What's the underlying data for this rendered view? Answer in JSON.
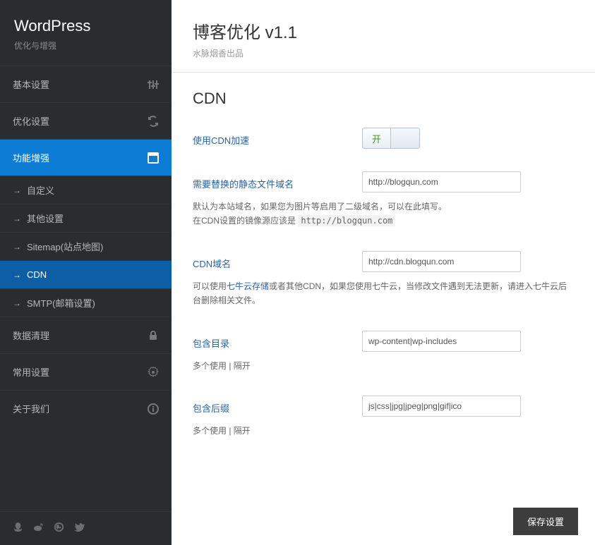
{
  "brand": {
    "title": "WordPress",
    "sub": "优化与增强"
  },
  "nav": {
    "items": [
      {
        "label": "基本设置",
        "icon": "sliders-icon"
      },
      {
        "label": "优化设置",
        "icon": "refresh-icon"
      },
      {
        "label": "功能增强",
        "icon": "panel-icon",
        "active": true
      },
      {
        "label": "数据清理",
        "icon": "lock-icon"
      },
      {
        "label": "常用设置",
        "icon": "gear-icon"
      },
      {
        "label": "关于我们",
        "icon": "info-icon"
      }
    ],
    "subitems": [
      {
        "label": "自定义"
      },
      {
        "label": "其他设置"
      },
      {
        "label": "Sitemap(站点地图)"
      },
      {
        "label": "CDN",
        "active": true
      },
      {
        "label": "SMTP(邮箱设置)"
      }
    ]
  },
  "header": {
    "title": "博客优化 v1.1",
    "sub": "水脉烟香出品"
  },
  "section": {
    "title": "CDN"
  },
  "form": {
    "enable": {
      "label": "使用CDN加速",
      "on_text": "开"
    },
    "domain": {
      "label": "需要替换的静态文件域名",
      "value": "http://blogqun.com",
      "help1": "默认为本站域名，如果您为图片等启用了二级域名，可以在此填写。",
      "help2_pre": "在CDN设置的镜像源应该是 ",
      "help2_code": "http://blogqun.com"
    },
    "cdn": {
      "label": "CDN域名",
      "value": "http://cdn.blogqun.com",
      "help_pre": "可以使用",
      "help_link": "七牛云存储",
      "help_post": "或者其他CDN，如果您使用七牛云，当修改文件遇到无法更新，请进入七牛云后台删除相关文件。"
    },
    "dirs": {
      "label": "包含目录",
      "value": "wp-content|wp-includes",
      "help": "多个使用 | 隔开"
    },
    "exts": {
      "label": "包含后缀",
      "value": "js|css|jpg|jpeg|png|gif|ico",
      "help": "多个使用 | 隔开"
    }
  },
  "save": {
    "label": "保存设置"
  }
}
